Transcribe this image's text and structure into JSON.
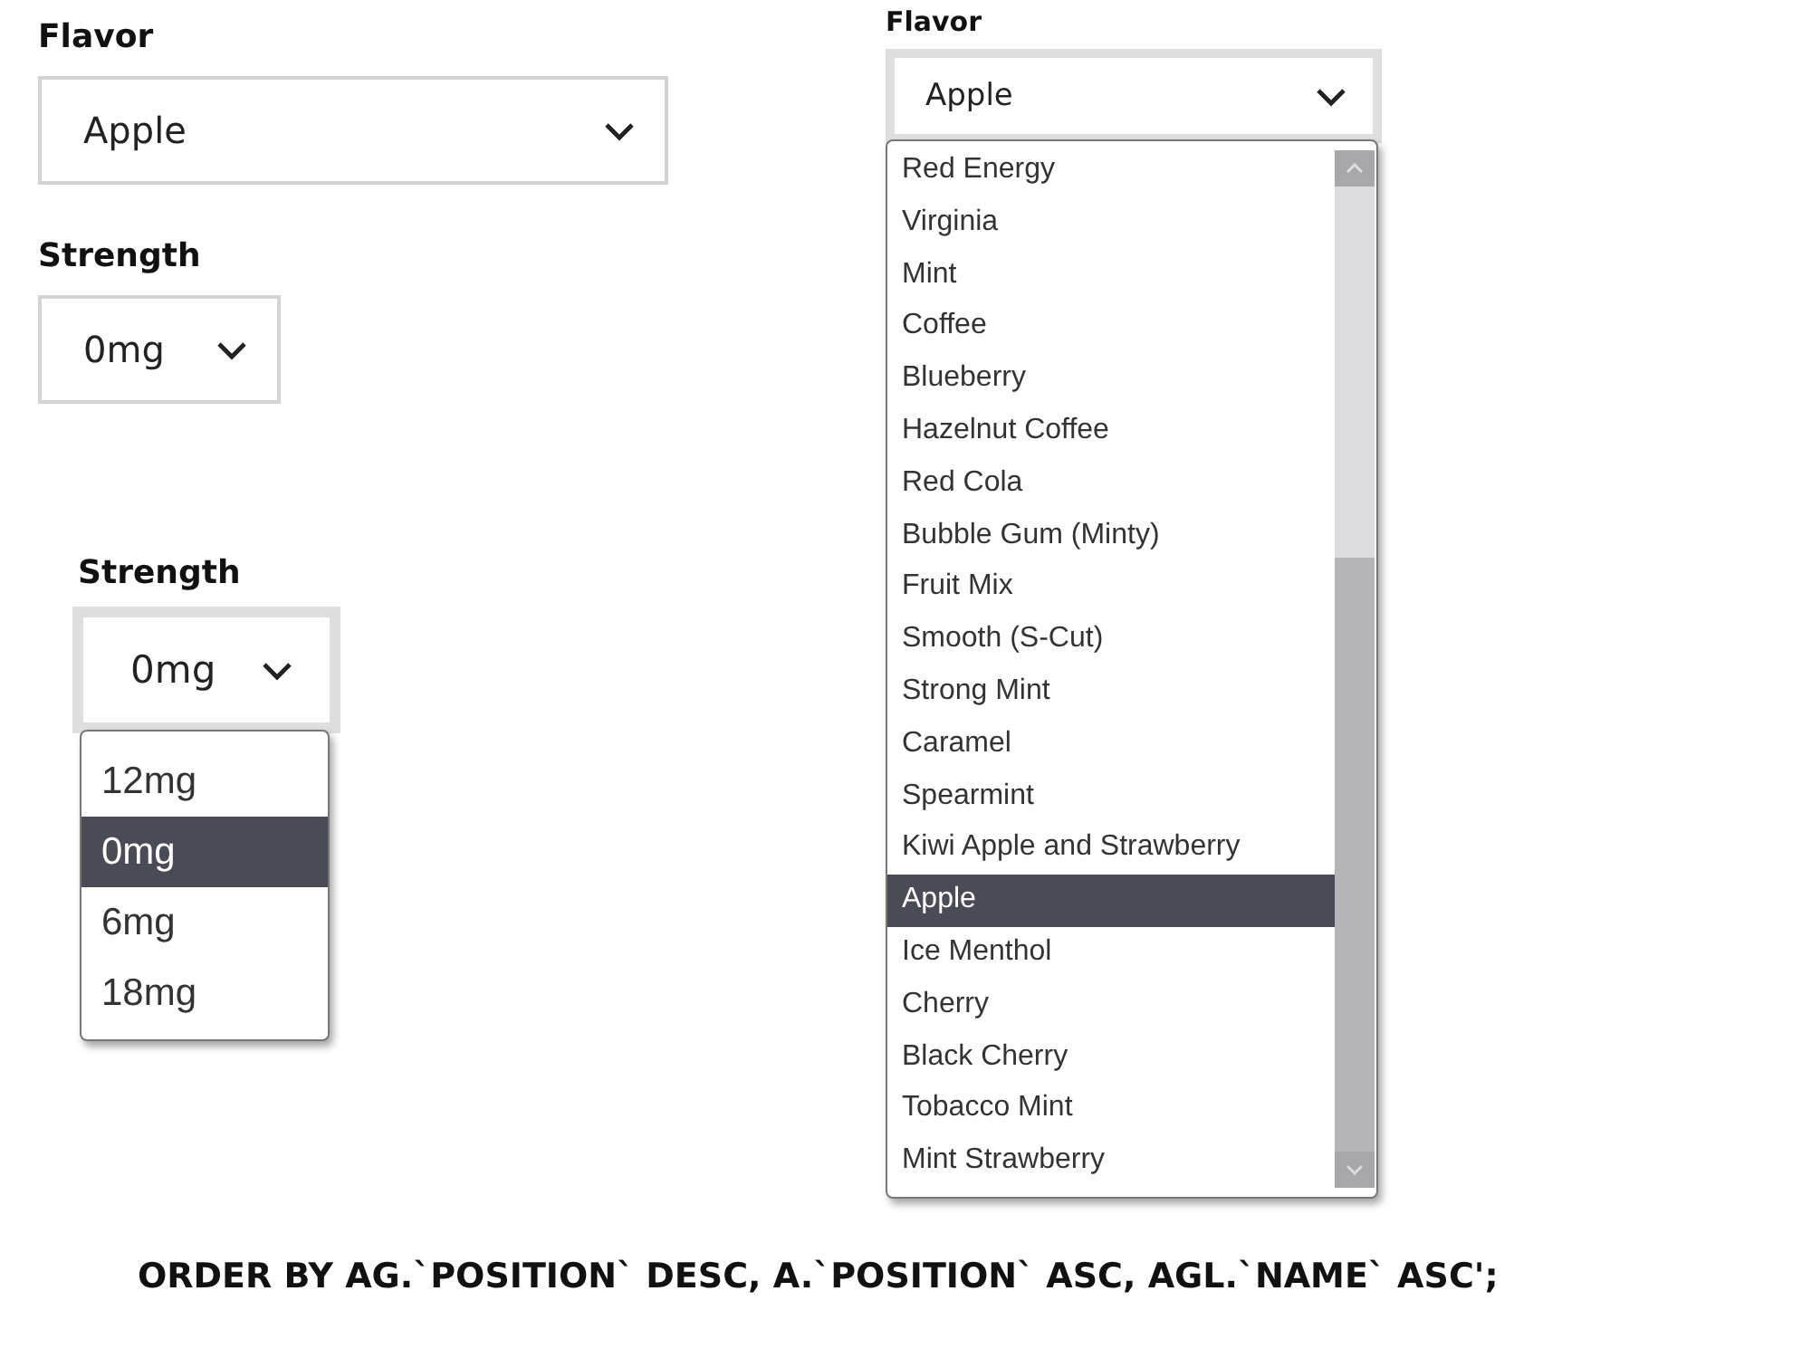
{
  "flavor_select": {
    "label": "Flavor",
    "value": "Apple"
  },
  "strength_select": {
    "label": "Strength",
    "value": "0mg"
  },
  "strength_dropdown": {
    "label": "Strength",
    "value": "0mg",
    "options": [
      {
        "text": "12mg",
        "selected": false
      },
      {
        "text": "0mg",
        "selected": true
      },
      {
        "text": "6mg",
        "selected": false
      },
      {
        "text": "18mg",
        "selected": false
      }
    ]
  },
  "flavor_dropdown": {
    "label": "Flavor",
    "value": "Apple",
    "options": [
      {
        "text": "Red Energy",
        "selected": false
      },
      {
        "text": "Virginia",
        "selected": false
      },
      {
        "text": "Mint",
        "selected": false
      },
      {
        "text": "Coffee",
        "selected": false
      },
      {
        "text": "Blueberry",
        "selected": false
      },
      {
        "text": "Hazelnut Coffee",
        "selected": false
      },
      {
        "text": "Red Cola",
        "selected": false
      },
      {
        "text": "Bubble Gum (Minty)",
        "selected": false
      },
      {
        "text": "Fruit Mix",
        "selected": false
      },
      {
        "text": "Smooth (S-Cut)",
        "selected": false
      },
      {
        "text": "Strong Mint",
        "selected": false
      },
      {
        "text": "Caramel",
        "selected": false
      },
      {
        "text": "Spearmint",
        "selected": false
      },
      {
        "text": "Kiwi Apple and Strawberry",
        "selected": false
      },
      {
        "text": "Apple",
        "selected": true
      },
      {
        "text": "Ice Menthol",
        "selected": false
      },
      {
        "text": "Cherry",
        "selected": false
      },
      {
        "text": "Black Cherry",
        "selected": false
      },
      {
        "text": "Tobacco Mint",
        "selected": false
      },
      {
        "text": "Mint Strawberry",
        "selected": false
      }
    ]
  },
  "caption": "ORDER BY AG.`POSITION` DESC, A.`POSITION` ASC, AGL.`NAME` ASC';"
}
